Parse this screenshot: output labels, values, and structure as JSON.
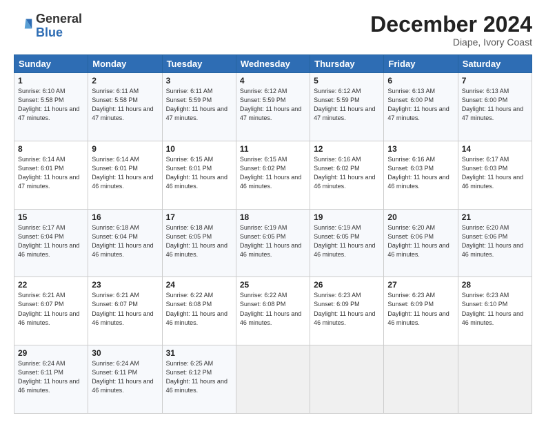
{
  "logo": {
    "general": "General",
    "blue": "Blue"
  },
  "header": {
    "month": "December 2024",
    "location": "Diape, Ivory Coast"
  },
  "weekdays": [
    "Sunday",
    "Monday",
    "Tuesday",
    "Wednesday",
    "Thursday",
    "Friday",
    "Saturday"
  ],
  "weeks": [
    [
      {
        "day": "1",
        "sunrise": "6:10 AM",
        "sunset": "5:58 PM",
        "daylight": "11 hours and 47 minutes."
      },
      {
        "day": "2",
        "sunrise": "6:11 AM",
        "sunset": "5:58 PM",
        "daylight": "11 hours and 47 minutes."
      },
      {
        "day": "3",
        "sunrise": "6:11 AM",
        "sunset": "5:59 PM",
        "daylight": "11 hours and 47 minutes."
      },
      {
        "day": "4",
        "sunrise": "6:12 AM",
        "sunset": "5:59 PM",
        "daylight": "11 hours and 47 minutes."
      },
      {
        "day": "5",
        "sunrise": "6:12 AM",
        "sunset": "5:59 PM",
        "daylight": "11 hours and 47 minutes."
      },
      {
        "day": "6",
        "sunrise": "6:13 AM",
        "sunset": "6:00 PM",
        "daylight": "11 hours and 47 minutes."
      },
      {
        "day": "7",
        "sunrise": "6:13 AM",
        "sunset": "6:00 PM",
        "daylight": "11 hours and 47 minutes."
      }
    ],
    [
      {
        "day": "8",
        "sunrise": "6:14 AM",
        "sunset": "6:01 PM",
        "daylight": "11 hours and 47 minutes."
      },
      {
        "day": "9",
        "sunrise": "6:14 AM",
        "sunset": "6:01 PM",
        "daylight": "11 hours and 46 minutes."
      },
      {
        "day": "10",
        "sunrise": "6:15 AM",
        "sunset": "6:01 PM",
        "daylight": "11 hours and 46 minutes."
      },
      {
        "day": "11",
        "sunrise": "6:15 AM",
        "sunset": "6:02 PM",
        "daylight": "11 hours and 46 minutes."
      },
      {
        "day": "12",
        "sunrise": "6:16 AM",
        "sunset": "6:02 PM",
        "daylight": "11 hours and 46 minutes."
      },
      {
        "day": "13",
        "sunrise": "6:16 AM",
        "sunset": "6:03 PM",
        "daylight": "11 hours and 46 minutes."
      },
      {
        "day": "14",
        "sunrise": "6:17 AM",
        "sunset": "6:03 PM",
        "daylight": "11 hours and 46 minutes."
      }
    ],
    [
      {
        "day": "15",
        "sunrise": "6:17 AM",
        "sunset": "6:04 PM",
        "daylight": "11 hours and 46 minutes."
      },
      {
        "day": "16",
        "sunrise": "6:18 AM",
        "sunset": "6:04 PM",
        "daylight": "11 hours and 46 minutes."
      },
      {
        "day": "17",
        "sunrise": "6:18 AM",
        "sunset": "6:05 PM",
        "daylight": "11 hours and 46 minutes."
      },
      {
        "day": "18",
        "sunrise": "6:19 AM",
        "sunset": "6:05 PM",
        "daylight": "11 hours and 46 minutes."
      },
      {
        "day": "19",
        "sunrise": "6:19 AM",
        "sunset": "6:05 PM",
        "daylight": "11 hours and 46 minutes."
      },
      {
        "day": "20",
        "sunrise": "6:20 AM",
        "sunset": "6:06 PM",
        "daylight": "11 hours and 46 minutes."
      },
      {
        "day": "21",
        "sunrise": "6:20 AM",
        "sunset": "6:06 PM",
        "daylight": "11 hours and 46 minutes."
      }
    ],
    [
      {
        "day": "22",
        "sunrise": "6:21 AM",
        "sunset": "6:07 PM",
        "daylight": "11 hours and 46 minutes."
      },
      {
        "day": "23",
        "sunrise": "6:21 AM",
        "sunset": "6:07 PM",
        "daylight": "11 hours and 46 minutes."
      },
      {
        "day": "24",
        "sunrise": "6:22 AM",
        "sunset": "6:08 PM",
        "daylight": "11 hours and 46 minutes."
      },
      {
        "day": "25",
        "sunrise": "6:22 AM",
        "sunset": "6:08 PM",
        "daylight": "11 hours and 46 minutes."
      },
      {
        "day": "26",
        "sunrise": "6:23 AM",
        "sunset": "6:09 PM",
        "daylight": "11 hours and 46 minutes."
      },
      {
        "day": "27",
        "sunrise": "6:23 AM",
        "sunset": "6:09 PM",
        "daylight": "11 hours and 46 minutes."
      },
      {
        "day": "28",
        "sunrise": "6:23 AM",
        "sunset": "6:10 PM",
        "daylight": "11 hours and 46 minutes."
      }
    ],
    [
      {
        "day": "29",
        "sunrise": "6:24 AM",
        "sunset": "6:11 PM",
        "daylight": "11 hours and 46 minutes."
      },
      {
        "day": "30",
        "sunrise": "6:24 AM",
        "sunset": "6:11 PM",
        "daylight": "11 hours and 46 minutes."
      },
      {
        "day": "31",
        "sunrise": "6:25 AM",
        "sunset": "6:12 PM",
        "daylight": "11 hours and 46 minutes."
      },
      null,
      null,
      null,
      null
    ]
  ]
}
